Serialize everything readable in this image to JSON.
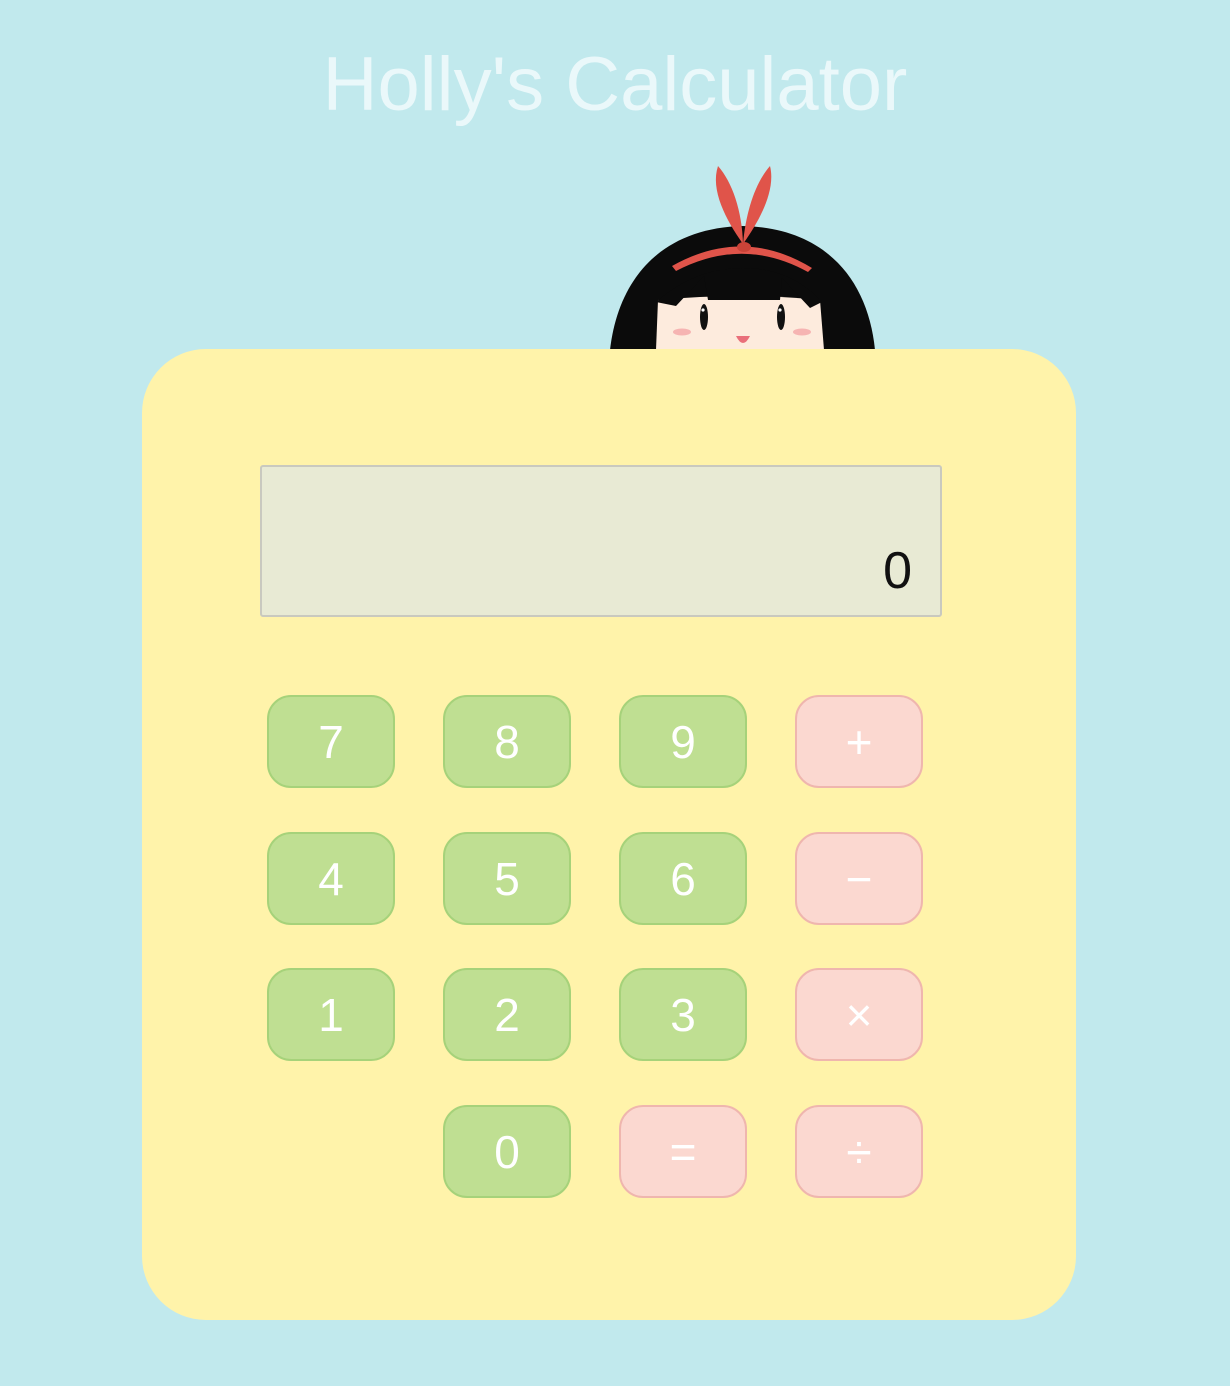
{
  "app": {
    "title": "Holly's Calculator"
  },
  "display": {
    "value": "0"
  },
  "keys": {
    "seven": "7",
    "eight": "8",
    "nine": "9",
    "plus": "+",
    "four": "4",
    "five": "5",
    "six": "6",
    "minus": "−",
    "one": "1",
    "two": "2",
    "three": "3",
    "multiply": "×",
    "zero": "0",
    "equals": "=",
    "divide": "÷"
  },
  "colors": {
    "background": "#c1e9ed",
    "calculator_body": "#fff3aa",
    "display_bg": "#e8ead4",
    "number_key": "#bfdf92",
    "operator_key": "#fbd8d0",
    "title_text": "#eaf8fa"
  },
  "icons": {
    "mascot": "girl-with-red-headband-icon"
  }
}
